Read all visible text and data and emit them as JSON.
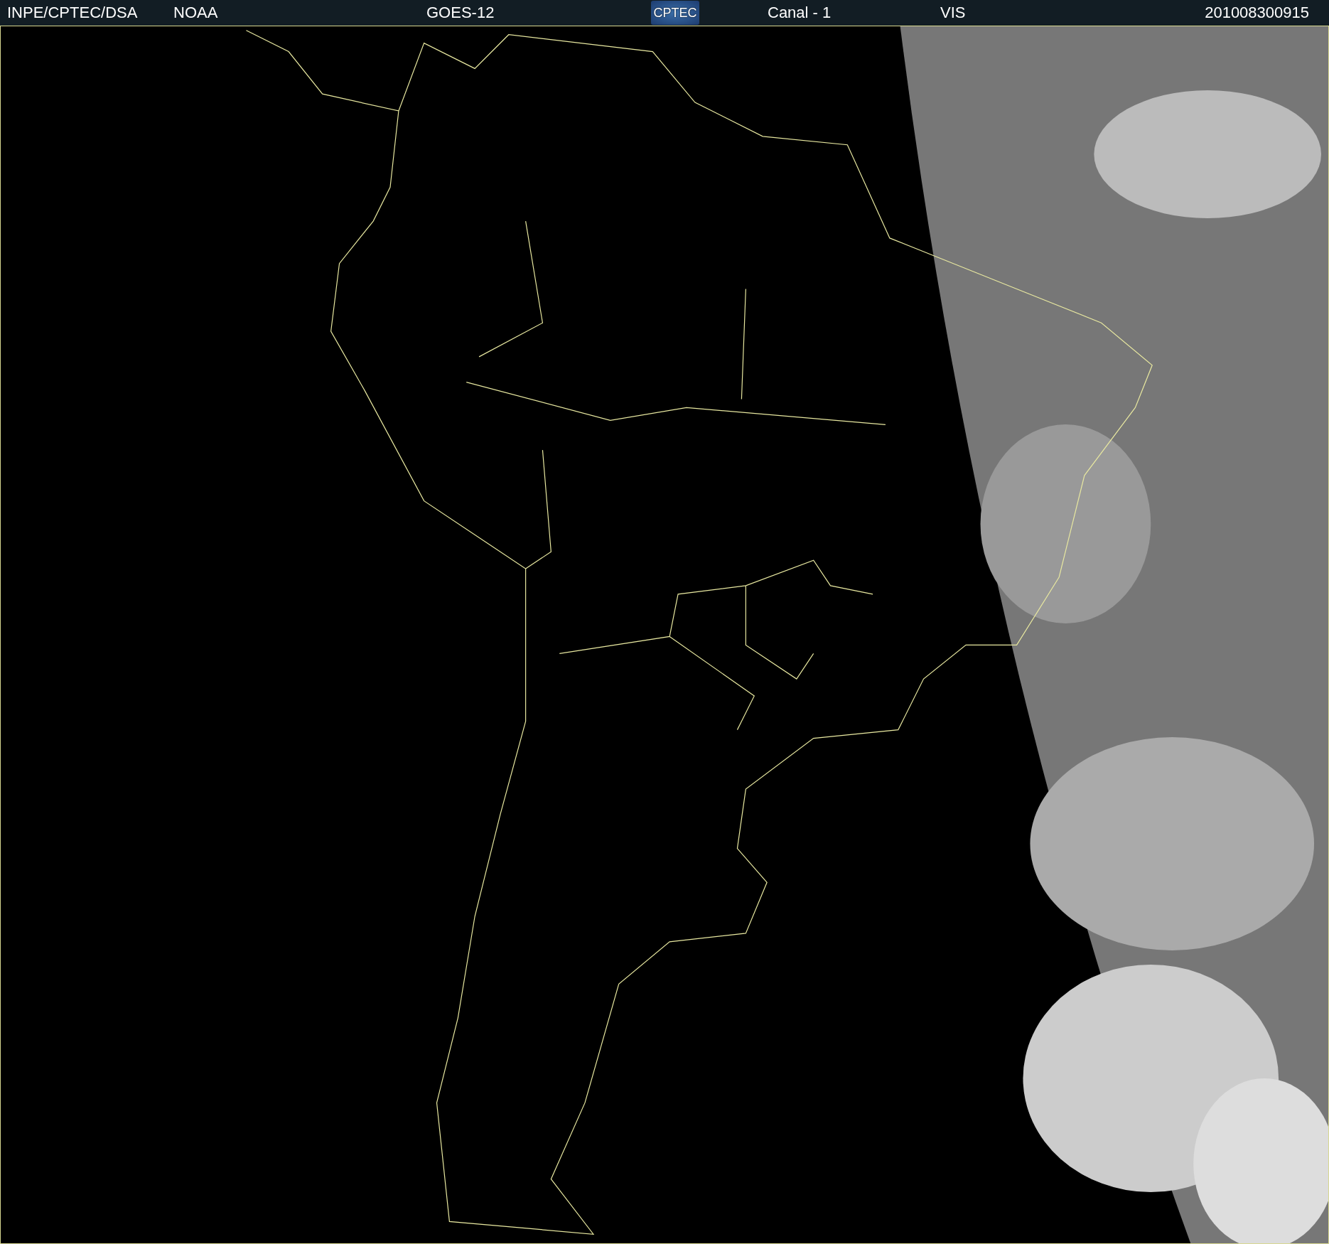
{
  "header": {
    "source": "INPE/CPTEC/DSA",
    "agency": "NOAA",
    "satellite": "GOES-12",
    "logo": "CPTEC",
    "channel": "Canal - 1",
    "band": "VIS",
    "timestamp": "201008300915"
  }
}
